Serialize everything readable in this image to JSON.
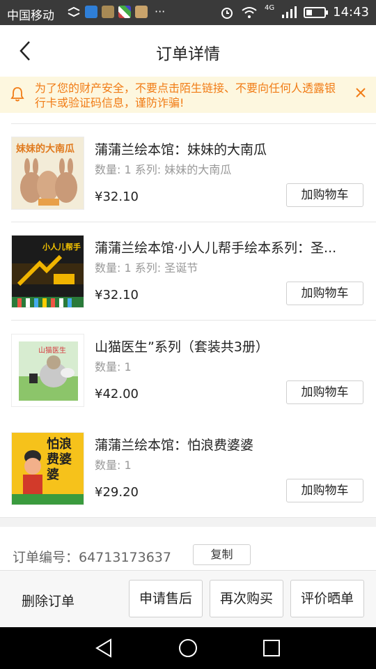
{
  "status_bar": {
    "carrier": "中国移动",
    "more": "···",
    "network": "4G",
    "time": "14:43"
  },
  "header": {
    "title": "订单详情"
  },
  "banner": {
    "text": "为了您的财产安全，不要点击陌生链接、不要向任何人透露银行卡或验证码信息，谨防诈骗!",
    "color": "#f17c16",
    "background": "#fdf7df"
  },
  "items": [
    {
      "title": "蒲蒲兰绘本馆：妹妹的大南瓜",
      "meta": "数量: 1 系列: 妹妹的大南瓜",
      "price": "¥32.10",
      "cart_label": "加购物车",
      "cover_text": "妹妹的大南瓜"
    },
    {
      "title": "蒲蒲兰绘本馆·小人儿帮手绘本系列：圣...",
      "meta": "数量: 1 系列: 圣诞节",
      "price": "¥32.10",
      "cart_label": "加购物车",
      "cover_text": "小人儿帮手"
    },
    {
      "title": "山猫医生”系列（套装共3册）",
      "meta": "数量: 1",
      "price": "¥42.00",
      "cart_label": "加购物车",
      "cover_text": "山猫医生"
    },
    {
      "title": "蒲蒲兰绘本馆：怕浪费婆婆",
      "meta": "数量: 1",
      "price": "¥29.20",
      "cart_label": "加购物车",
      "cover_text": "怕浪费婆婆"
    }
  ],
  "order": {
    "number_label": "订单编号：64713173637",
    "copy_label": "复制"
  },
  "actions": {
    "delete": "删除订单",
    "after_sale": "申请售后",
    "rebuy": "再次购买",
    "review": "评价晒单"
  }
}
